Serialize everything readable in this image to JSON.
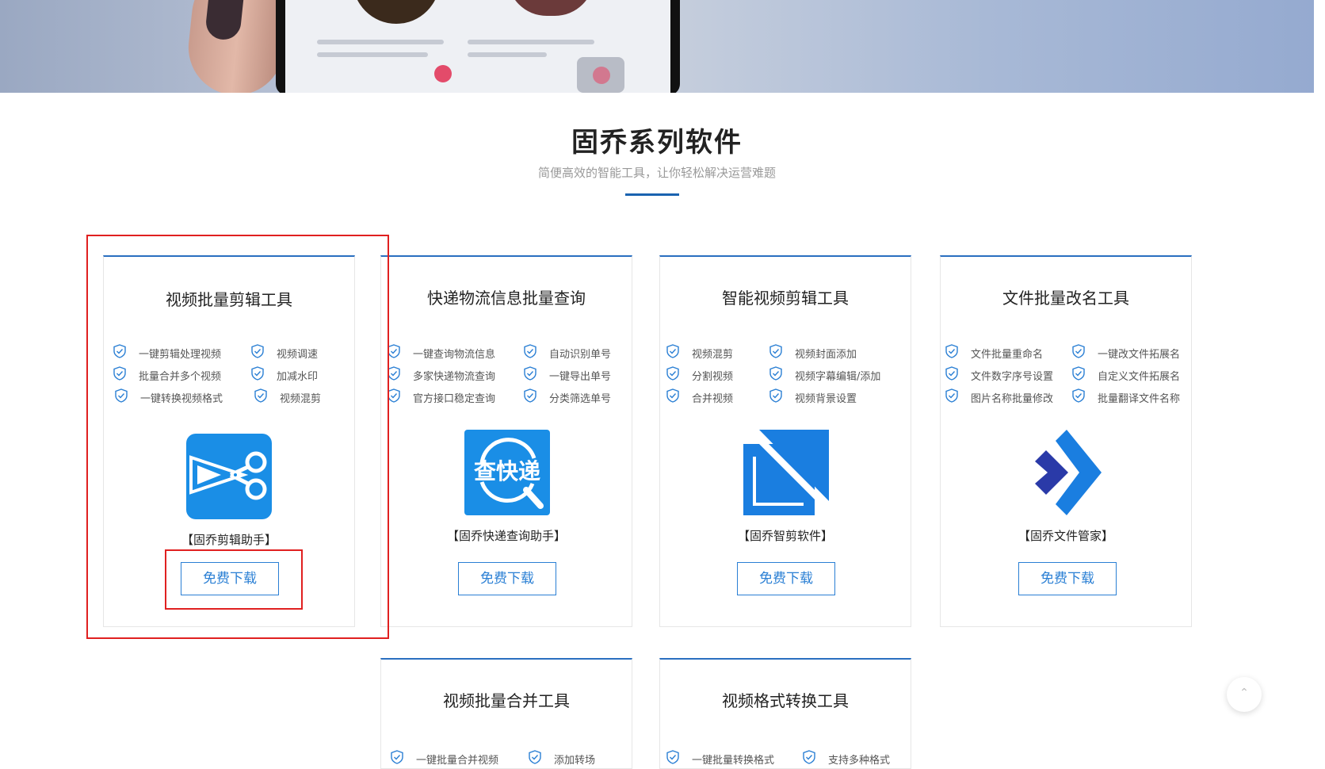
{
  "section": {
    "title": "固乔系列软件",
    "subtitle": "简便高效的智能工具，让你轻松解决运营难题"
  },
  "download_label": "免费下载",
  "colors": {
    "accent": "#2a7fd4",
    "highlight": "#e02020",
    "title_rule": "#1a63b0"
  },
  "cards": [
    {
      "title": "视频批量剪辑工具",
      "features": [
        "一键剪辑处理视频",
        "视频调速",
        "批量合并多个视频",
        "加减水印",
        "一键转换视频格式",
        "视频混剪"
      ],
      "app_name": "【固乔剪辑助手】",
      "icon": "scissors-icon"
    },
    {
      "title": "快递物流信息批量查询",
      "features": [
        "一键查询物流信息",
        "自动识别单号",
        "多家快递物流查询",
        "一键导出单号",
        "官方接口稳定查询",
        "分类筛选单号"
      ],
      "app_name": "【固乔快递查询助手】",
      "icon": "express-search-icon",
      "icon_text": "查快递"
    },
    {
      "title": "智能视频剪辑工具",
      "features": [
        "视频混剪",
        "视频封面添加",
        "分割视频",
        "视频字幕编辑/添加",
        "合并视频",
        "视频背景设置"
      ],
      "app_name": "【固乔智剪软件】",
      "icon": "smart-clip-icon"
    },
    {
      "title": "文件批量改名工具",
      "features": [
        "文件批量重命名",
        "一键改文件拓展名",
        "文件数字序号设置",
        "自定义文件拓展名",
        "图片名称批量修改",
        "批量翻译文件名称"
      ],
      "app_name": "【固乔文件管家】",
      "icon": "file-manager-icon"
    },
    {
      "title": "视频批量合并工具",
      "features": [
        "一键批量合并视频",
        "添加转场"
      ]
    },
    {
      "title": "视频格式转换工具",
      "features": [
        "一键批量转换格式",
        "支持多种格式"
      ]
    }
  ],
  "back_to_top_icon": "chevron-up-icon"
}
